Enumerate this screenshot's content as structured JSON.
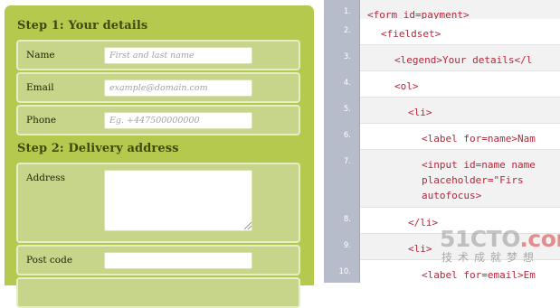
{
  "form": {
    "step1_title": "Step 1: Your details",
    "step2_title": "Step 2: Delivery address",
    "fields": {
      "name": {
        "label": "Name",
        "placeholder": "First and last name"
      },
      "email": {
        "label": "Email",
        "placeholder": "example@domain.com"
      },
      "phone": {
        "label": "Phone",
        "placeholder": "Eg. +447500000000"
      },
      "address": {
        "label": "Address"
      },
      "postcode": {
        "label": "Post code"
      }
    }
  },
  "code": {
    "lines": [
      {
        "number": "1.",
        "text": "<form id=payment>"
      },
      {
        "number": "2.",
        "text": "<fieldset>"
      },
      {
        "number": "3.",
        "text": "<legend>Your details</l"
      },
      {
        "number": "4.",
        "text": "<ol>"
      },
      {
        "number": "5.",
        "text": "<li>"
      },
      {
        "number": "6.",
        "text": "<label for=name>Nam"
      },
      {
        "number": "7.",
        "text": "<input id=name name\nplaceholder=\"Firs\nautofocus>"
      },
      {
        "number": "8.",
        "text": "</li>"
      },
      {
        "number": "9.",
        "text": "<li>"
      },
      {
        "number": "10.",
        "text": "<label for=email>Em"
      }
    ]
  },
  "watermark": {
    "brand_main": "51CTO",
    "brand_suffix": ".com",
    "tagline": "技术成就梦想"
  }
}
